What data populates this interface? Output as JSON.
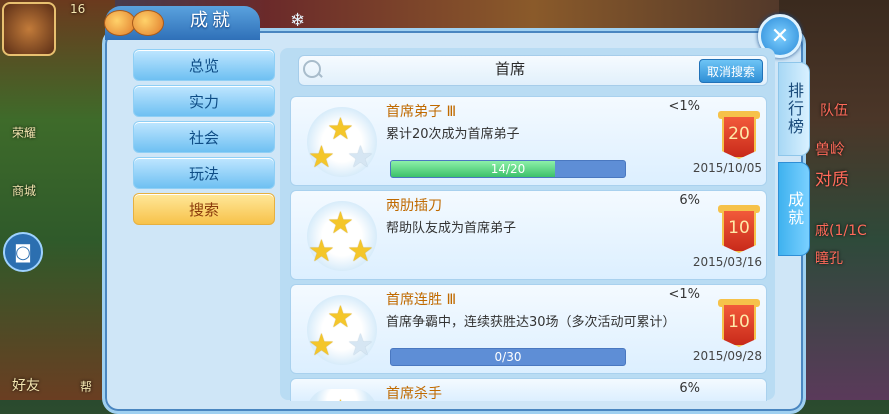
{
  "panel": {
    "title": "成就",
    "close_label": "✕"
  },
  "hud": {
    "top_number": "16",
    "left_labels": [
      "荣耀",
      "商城",
      "好友",
      "帮"
    ],
    "right_labels": [
      "队伍",
      "兽岭",
      "对质",
      "戚(1/1C",
      "瞳孔"
    ]
  },
  "nav": {
    "items": [
      {
        "label": "总览",
        "active": false
      },
      {
        "label": "实力",
        "active": false
      },
      {
        "label": "社会",
        "active": false
      },
      {
        "label": "玩法",
        "active": false
      },
      {
        "label": "搜索",
        "active": true
      }
    ]
  },
  "search": {
    "value": "首席",
    "cancel_label": "取消搜索"
  },
  "side_tabs": {
    "rank": "排行榜",
    "achievement": "成就"
  },
  "achievements": [
    {
      "name": "首席弟子 Ⅲ",
      "desc": "累计20次成为首席弟子",
      "pct": "<1%",
      "date": "2015/10/05",
      "points": "20",
      "progress_text": "14/20",
      "progress_value": 0.7,
      "stars_gold": 2
    },
    {
      "name": "两肋插刀",
      "desc": "帮助队友成为首席弟子",
      "pct": "6%",
      "date": "2015/03/16",
      "points": "10",
      "stars_gold": 3
    },
    {
      "name": "首席连胜 Ⅲ",
      "desc": "首席争霸中，连续获胜达30场（多次活动可累计）",
      "pct": "<1%",
      "date": "2015/09/28",
      "points": "10",
      "progress_text": "0/30",
      "progress_value": 0,
      "stars_gold": 2
    },
    {
      "name": "首席杀手",
      "pct": "6%",
      "stars_gold": 1
    }
  ],
  "colors": {
    "accent": "#3fb2ef",
    "nav_active": "#f7c24a",
    "achievement_name": "#c06a00",
    "badge": "#d8381e"
  },
  "icons": [
    "camera-icon",
    "search-icon",
    "close-icon",
    "star-icon",
    "badge-icon"
  ]
}
